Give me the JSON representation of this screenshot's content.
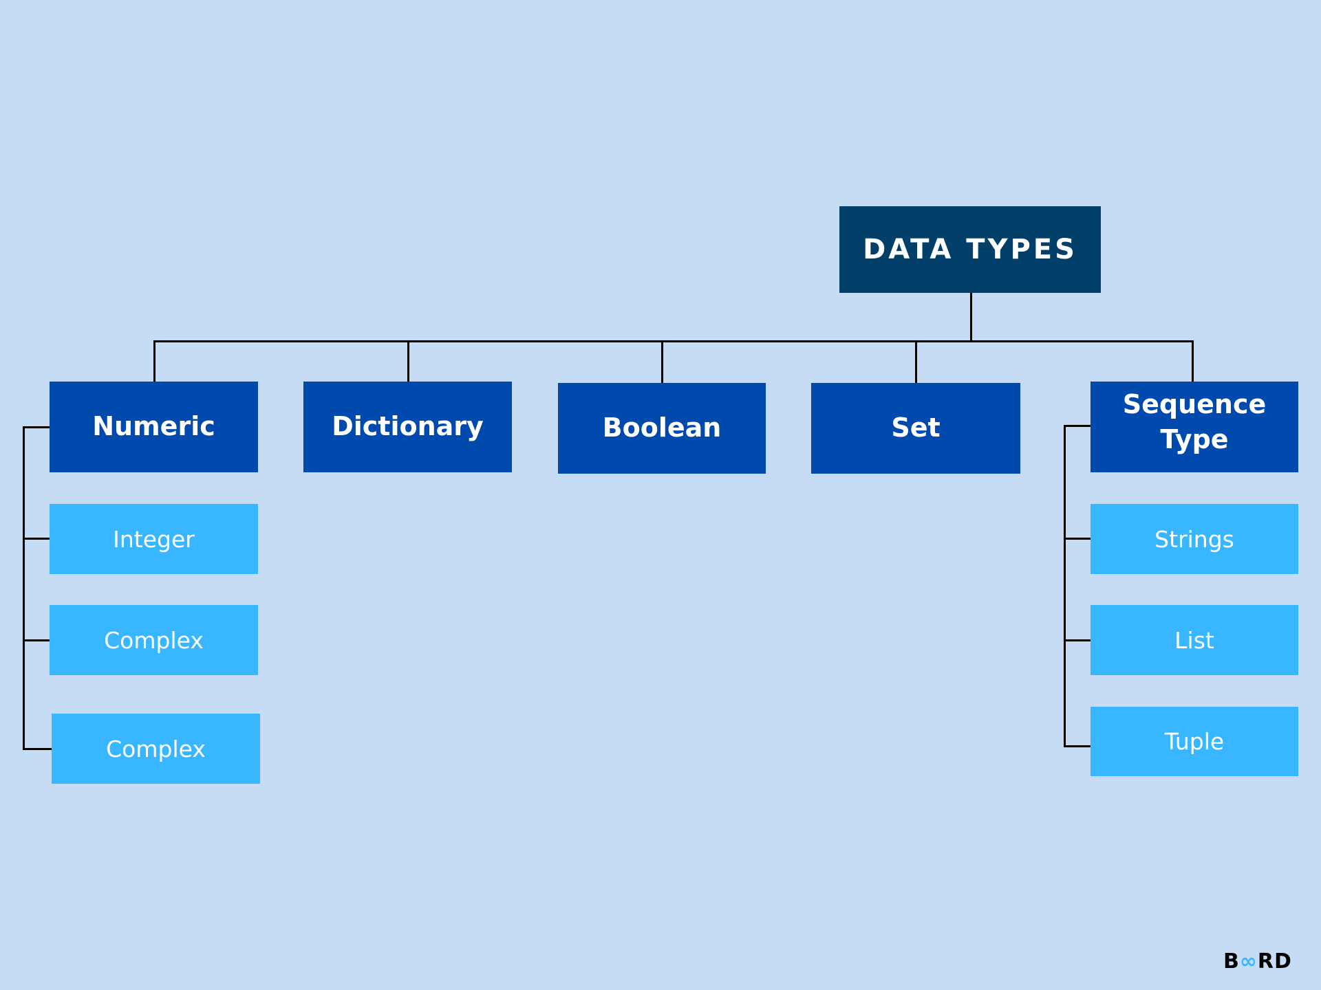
{
  "root": {
    "label": "DATA TYPES"
  },
  "categories": [
    {
      "label": "Numeric"
    },
    {
      "label": "Dictionary"
    },
    {
      "label": "Boolean"
    },
    {
      "label": "Set"
    },
    {
      "label": "Sequence\nType"
    }
  ],
  "numeric_children": [
    {
      "label": "Integer"
    },
    {
      "label": "Complex"
    },
    {
      "label": "Complex"
    }
  ],
  "sequence_children": [
    {
      "label": "Strings"
    },
    {
      "label": "List"
    },
    {
      "label": "Tuple"
    }
  ],
  "logo": {
    "prefix": "B",
    "mark": "∞",
    "suffix": "RD"
  },
  "colors": {
    "background": "#c6dcf5",
    "root": "#02406a",
    "category": "#004aad",
    "subtype": "#38b6ff",
    "connector": "#000000"
  }
}
